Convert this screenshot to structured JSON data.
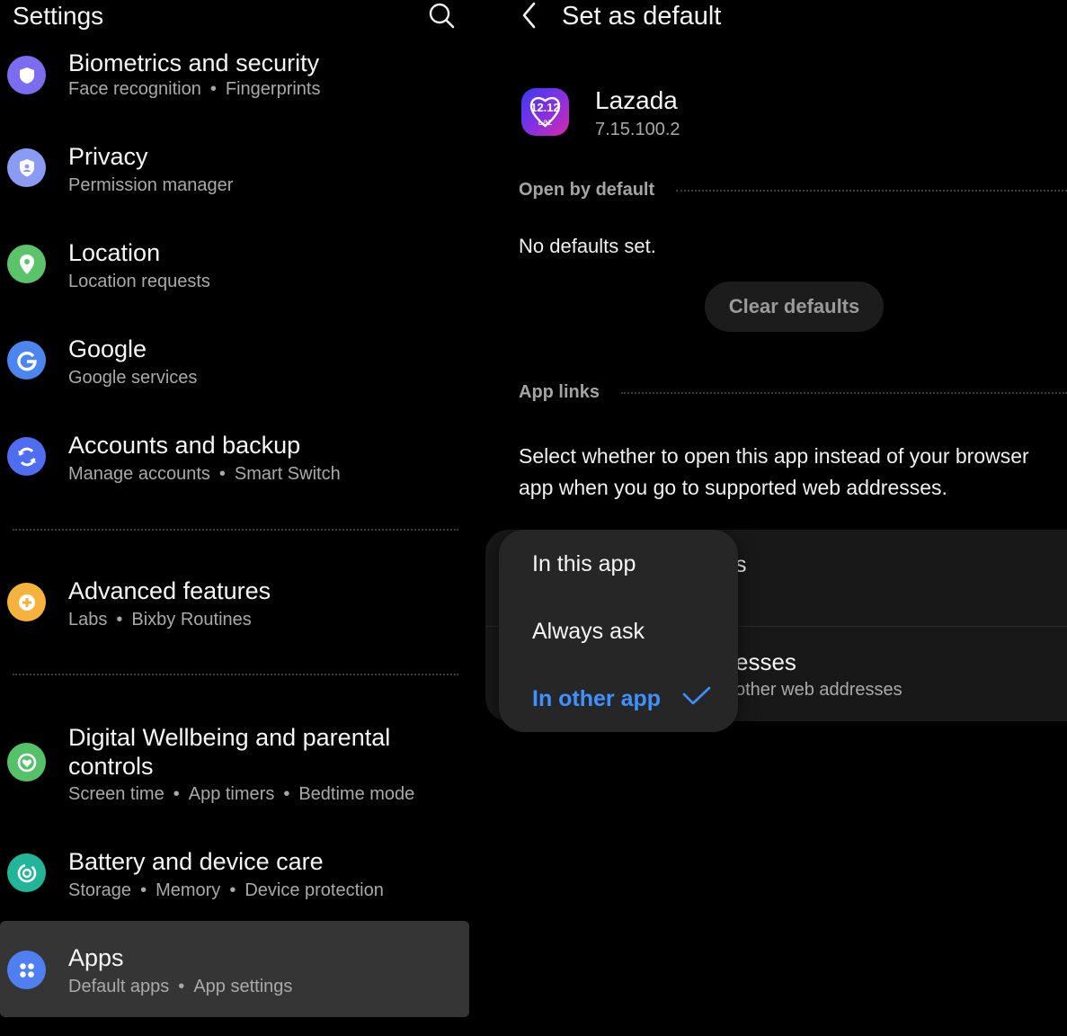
{
  "left": {
    "title": "Settings",
    "rows": [
      {
        "title": "Biometrics and security",
        "subs": [
          "Face recognition",
          "Fingerprints"
        ],
        "icon": "shield-icon"
      },
      {
        "title": "Privacy",
        "subs": [
          "Permission manager"
        ],
        "icon": "privacy-shield-icon"
      },
      {
        "title": "Location",
        "subs": [
          "Location requests"
        ],
        "icon": "location-pin-icon"
      },
      {
        "title": "Google",
        "subs": [
          "Google services"
        ],
        "icon": "google-g-icon"
      },
      {
        "title": "Accounts and backup",
        "subs": [
          "Manage accounts",
          "Smart Switch"
        ],
        "icon": "sync-icon"
      },
      {
        "title": "Advanced features",
        "subs": [
          "Labs",
          "Bixby Routines"
        ],
        "icon": "gear-plus-icon"
      },
      {
        "title": "Digital Wellbeing and parental",
        "title2": "controls",
        "subs": [
          "Screen time",
          "App timers",
          "Bedtime mode"
        ],
        "icon": "wellbeing-heart-icon"
      },
      {
        "title": "Battery and device care",
        "subs": [
          "Storage",
          "Memory",
          "Device protection"
        ],
        "icon": "device-care-icon"
      },
      {
        "title": "Apps",
        "subs": [
          "Default apps",
          "App settings"
        ],
        "icon": "apps-grid-icon"
      }
    ]
  },
  "right": {
    "title": "Set as default",
    "app": {
      "name": "Lazada",
      "version": "7.15.100.2",
      "icon_text_top": "12.12",
      "icon_text_bottom": "Laz"
    },
    "open_by_default_label": "Open by default",
    "no_defaults": "No defaults set.",
    "clear_defaults": "Clear defaults",
    "app_links_label": "App links",
    "description": "Select whether to open this app instead of your browser app when you go to supported web addresses.",
    "card": {
      "row1_partial": "s",
      "row2_partial": "esses",
      "row2_sub_partial": "other web addresses"
    },
    "popup": {
      "options": [
        "In this app",
        "Always ask",
        "In other app"
      ],
      "selected": "In other app"
    }
  },
  "colors": {
    "accent": "#3e91ff",
    "background": "#000000",
    "selected_row": "#353535"
  }
}
